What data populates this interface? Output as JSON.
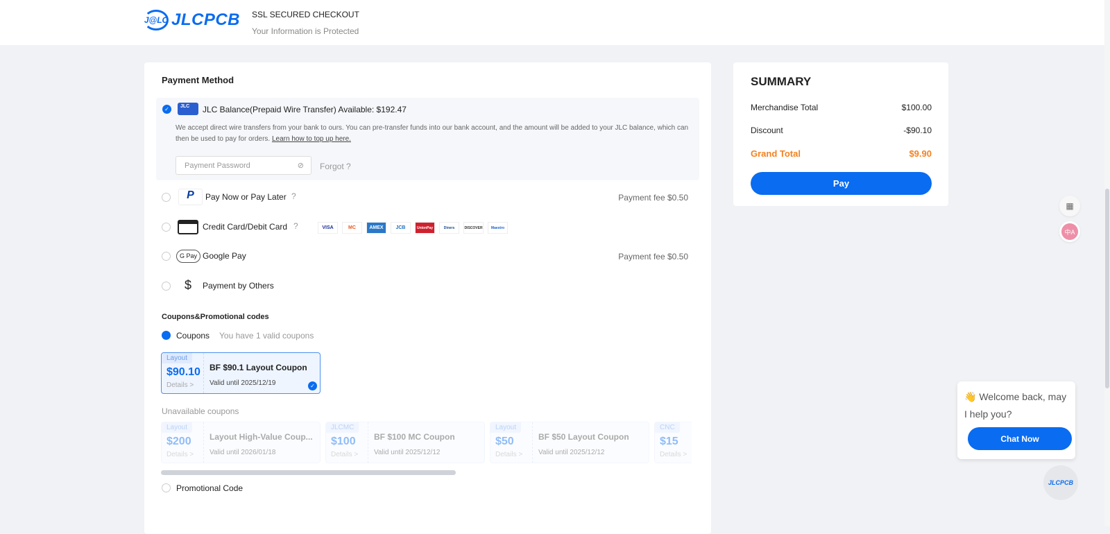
{
  "header": {
    "logo_mark": "J@LC",
    "logo_word": "JLCPCB",
    "ssl": "SSL SECURED CHECKOUT",
    "protected": "Your Information is Protected"
  },
  "payment": {
    "title": "Payment Method",
    "balance": {
      "label": "JLC Balance(Prepaid Wire Transfer) Available: $192.47",
      "icon_text": "JLC",
      "desc": "We accept direct wire transfers from your bank to ours. You can pre-transfer funds into our bank account, and the amount will be added to your JLC balance, which can then be used to pay for orders.",
      "link": "Learn how to top up here.",
      "password_placeholder": "Payment Password",
      "forgot": "Forgot ?"
    },
    "paypal": {
      "label": "Pay Now or Pay Later",
      "fee": "Payment fee $0.50"
    },
    "card": {
      "label": "Credit Card/Debit Card",
      "brands": [
        "VISA",
        "MC",
        "AMEX",
        "JCB",
        "UnionPay",
        "Diners",
        "DISCOVER",
        "Maestro"
      ]
    },
    "gpay": {
      "icon_text": "G Pay",
      "label": "Google Pay",
      "fee": "Payment fee $0.50"
    },
    "others": {
      "label": "Payment by Others"
    }
  },
  "coupons": {
    "title": "Coupons&Promotional codes",
    "option": "Coupons",
    "valid_count": "You have 1 valid coupons",
    "selected": {
      "tag": "Layout",
      "amount": "$90.10",
      "details": "Details >",
      "name": "BF $90.1 Layout Coupon",
      "valid": "Valid until 2025/12/19"
    },
    "unavailable_title": "Unavailable coupons",
    "unavailable": [
      {
        "tag": "Layout",
        "amount": "$200",
        "details": "Details >",
        "name": "Layout High-Value Coup...",
        "valid": "Valid until 2026/01/18"
      },
      {
        "tag": "JLCMC",
        "amount": "$100",
        "details": "Details >",
        "name": "BF $100 MC Coupon",
        "valid": "Valid until 2025/12/12"
      },
      {
        "tag": "Layout",
        "amount": "$50",
        "details": "Details >",
        "name": "BF $50 Layout Coupon",
        "valid": "Valid until 2025/12/12"
      },
      {
        "tag": "CNC",
        "amount": "$15",
        "details": "Details >",
        "name": "",
        "valid": ""
      }
    ],
    "promo": "Promotional Code"
  },
  "summary": {
    "title": "SUMMARY",
    "merch_label": "Merchandise Total",
    "merch": "$100.00",
    "discount_label": "Discount",
    "discount": "-$90.10",
    "grand_label": "Grand Total",
    "grand": "$9.90",
    "pay": "Pay"
  },
  "chat": {
    "message": "👋 Welcome back, may I help you?",
    "button": "Chat Now",
    "bot": "JLCPCB"
  },
  "side": {
    "lang": "中A"
  }
}
